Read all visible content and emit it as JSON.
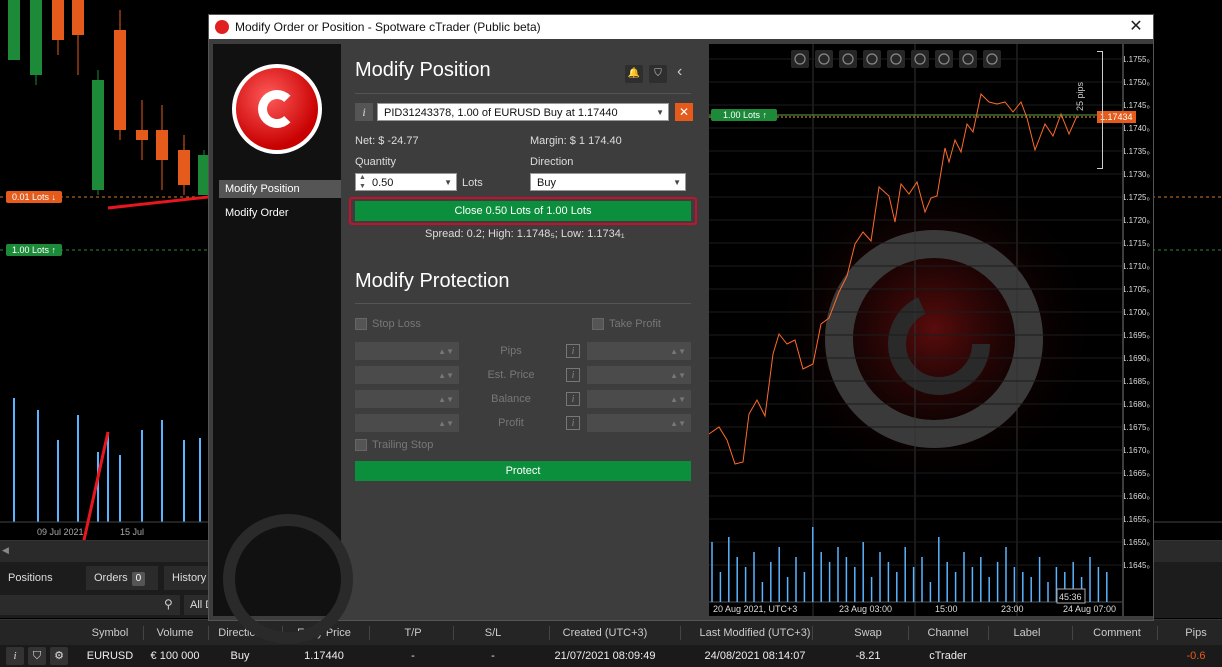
{
  "background": {
    "badge_sell": "0.01 Lots ↓",
    "badge_buy": "1.00 Lots ↑",
    "x_labels": [
      "09 Jul 2021",
      "15 Jul"
    ]
  },
  "bottom_tabs": [
    {
      "label": "Positions",
      "count": "6"
    },
    {
      "label": "Orders",
      "count": "0"
    },
    {
      "label": "History",
      "count": ""
    }
  ],
  "filter_label": "All D",
  "table": {
    "headers": [
      "Symbol",
      "Volume",
      "Direction",
      "Entry Price",
      "T/P",
      "S/L",
      "Created (UTC+3)",
      "Last Modified (UTC+3)",
      "Swap",
      "Channel",
      "Label",
      "Comment",
      "Pips"
    ],
    "row": [
      "EURUSD",
      "€ 100 000",
      "Buy",
      "1.17440",
      "-",
      "-",
      "21/07/2021 08:09:49",
      "24/08/2021 08:14:07",
      "-8.21",
      "cTrader",
      "",
      "",
      "-0.6"
    ]
  },
  "dialog": {
    "title": "Modify Order or Position - Spotware cTrader (Public beta)",
    "close": "✕",
    "sidebar": [
      "Modify Position",
      "Modify Order"
    ],
    "position": {
      "heading": "Modify Position",
      "position_select": "PID31243378, 1.00 of EURUSD Buy at 1.17440",
      "net": "Net: $ -24.77",
      "margin": "Margin: $ 1 174.40",
      "quantity_label": "Quantity",
      "quantity_value": "0.50",
      "quantity_unit": "Lots",
      "direction_label": "Direction",
      "direction_value": "Buy",
      "close_button": "Close 0.50 Lots of 1.00 Lots",
      "spread_info": "Spread: 0.2; High: 1.1748₅; Low: 1.1734₁"
    },
    "protection": {
      "heading": "Modify Protection",
      "stop_loss": "Stop Loss",
      "take_profit": "Take Profit",
      "rows": [
        "Pips",
        "Est. Price",
        "Balance",
        "Profit"
      ],
      "trailing_stop": "Trailing Stop",
      "protect_button": "Protect"
    },
    "chart": {
      "lots_badge": "1.00 Lots ↑",
      "price_badge": "1.17434",
      "pips_label": "25 pips",
      "y_ticks": [
        "1.1755₀",
        "1.1750₀",
        "1.1745₀",
        "1.1740₀",
        "1.1735₀",
        "1.1730₀",
        "1.1725₀",
        "1.1720₀",
        "1.1715₀",
        "1.1710₀",
        "1.1705₀",
        "1.1700₀",
        "1.1695₀",
        "1.1690₀",
        "1.1685₀",
        "1.1680₀",
        "1.1675₀",
        "1.1670₀",
        "1.1665₀",
        "1.1660₀",
        "1.1655₀",
        "1.1650₀",
        "1.1645₀"
      ],
      "x_ticks": [
        "20 Aug 2021, UTC+3",
        "23 Aug 03:00",
        "15:00",
        "23:00",
        "24 Aug 07:00"
      ],
      "countdown": "45:36",
      "line_color": "#ff6a2a",
      "volume_color": "#5ab4ff"
    }
  }
}
